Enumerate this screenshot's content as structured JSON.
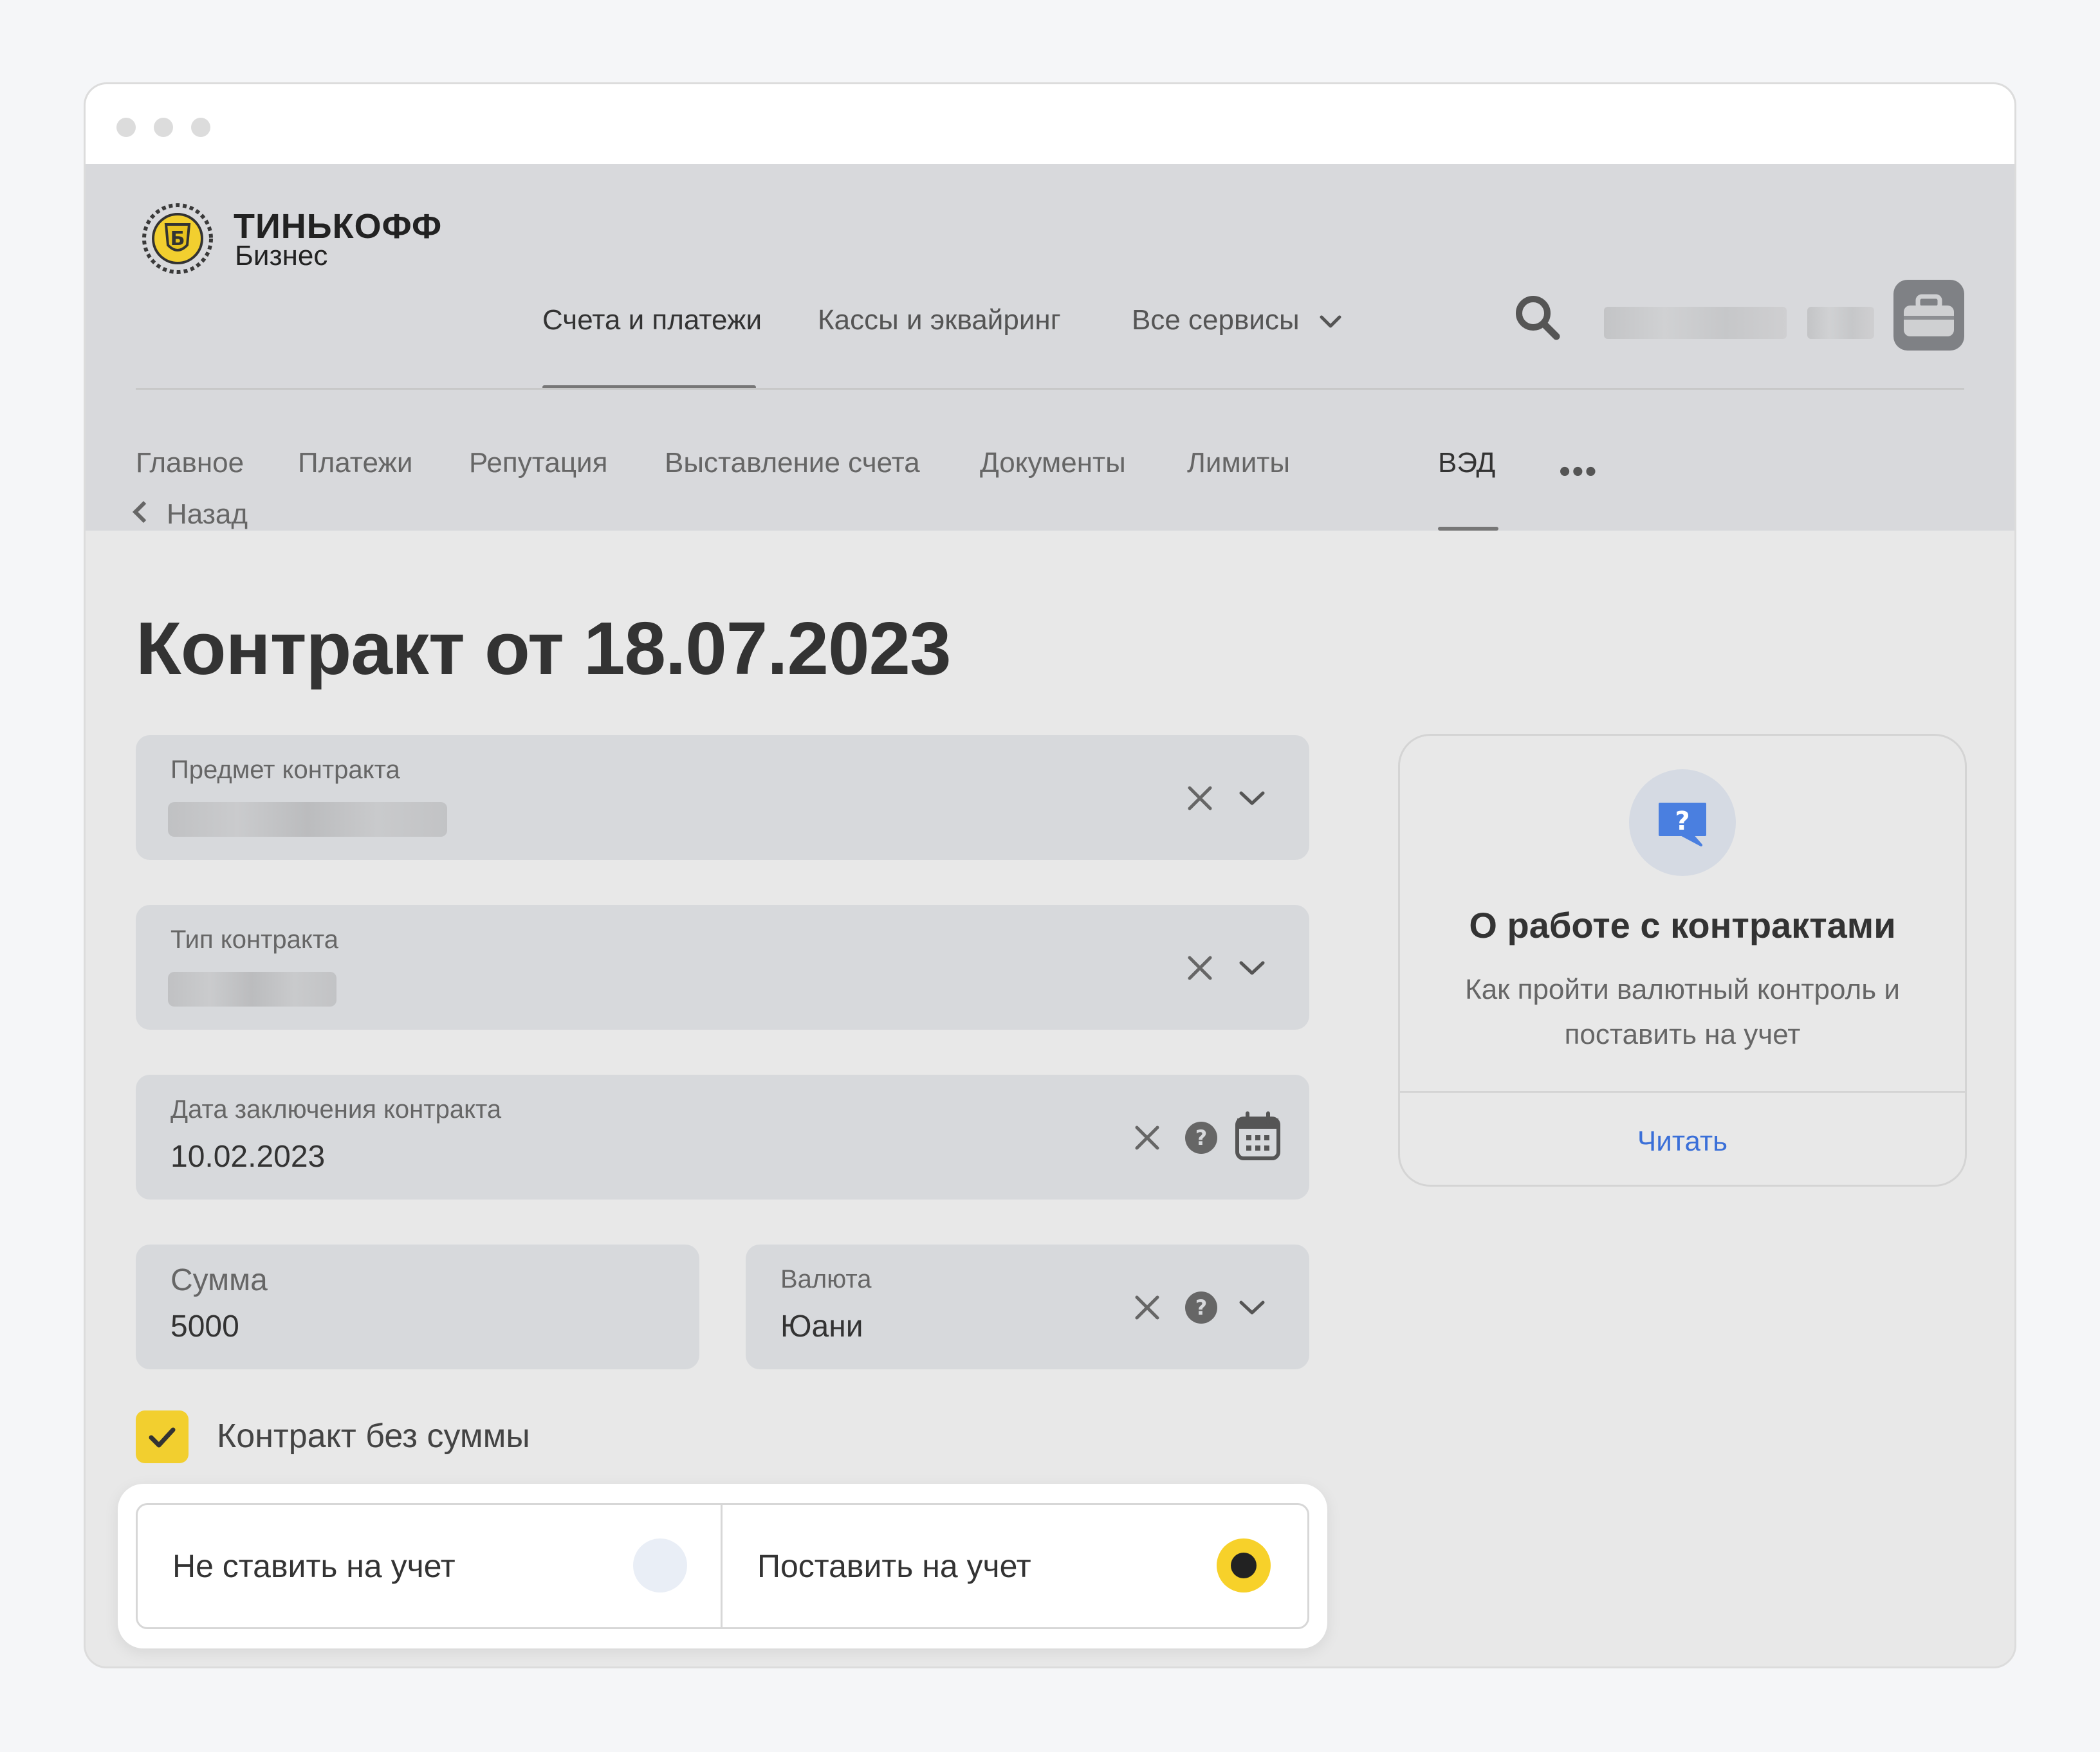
{
  "logo": {
    "line1": "ТИНЬКОФФ",
    "line2": "Бизнес"
  },
  "top_nav": [
    {
      "label": "Счета и платежи"
    },
    {
      "label": "Кассы и эквайринг"
    },
    {
      "label": "Все сервисы"
    }
  ],
  "sub_nav": [
    {
      "label": "Главное"
    },
    {
      "label": "Платежи"
    },
    {
      "label": "Репутация"
    },
    {
      "label": "Выставление счета"
    },
    {
      "label": "Документы"
    },
    {
      "label": "Лимиты"
    },
    {
      "label": "ВЭД"
    }
  ],
  "back_label": "Назад",
  "page_title": "Контракт от 18.07.2023",
  "fields": {
    "subject": {
      "label": "Предмет контракта"
    },
    "type": {
      "label": "Тип контракта"
    },
    "date": {
      "label": "Дата заключения контракта",
      "value": "10.02.2023"
    },
    "amount": {
      "label": "Сумма",
      "value": "5000"
    },
    "currency": {
      "label": "Валюта",
      "value": "Юани"
    }
  },
  "no_sum_checkbox": {
    "label": "Контракт без суммы",
    "checked": true
  },
  "registration": {
    "options": [
      {
        "label": "Не ставить на учет",
        "selected": false
      },
      {
        "label": "Поставить на учет",
        "selected": true
      }
    ]
  },
  "info_card": {
    "title": "О работе с контрактами",
    "description": "Как пройти валютный контроль и поставить на учет",
    "link": "Читать"
  },
  "colors": {
    "accent_yellow": "#f2cf2f",
    "link_blue": "#3a6fd8",
    "icon_blue": "#4a7fe0"
  }
}
